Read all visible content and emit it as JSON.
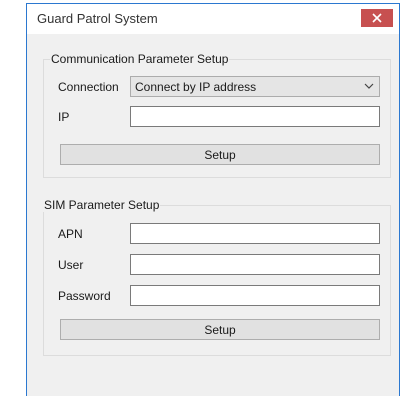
{
  "window": {
    "title": "Guard Patrol System"
  },
  "communication": {
    "group_title": "Communication Parameter Setup",
    "connection_label": "Connection",
    "connection_value": "Connect by IP address",
    "ip_label": "IP",
    "ip_value": "",
    "setup_label": "Setup"
  },
  "sim": {
    "group_title": "SIM Parameter Setup",
    "apn_label": "APN",
    "apn_value": "",
    "user_label": "User",
    "user_value": "",
    "password_label": "Password",
    "password_value": "",
    "setup_label": "Setup"
  },
  "icons": {
    "close": "close-icon",
    "dropdown": "chevron-down-icon"
  },
  "colors": {
    "close_button": "#c75050",
    "window_border": "#2b78d0"
  }
}
